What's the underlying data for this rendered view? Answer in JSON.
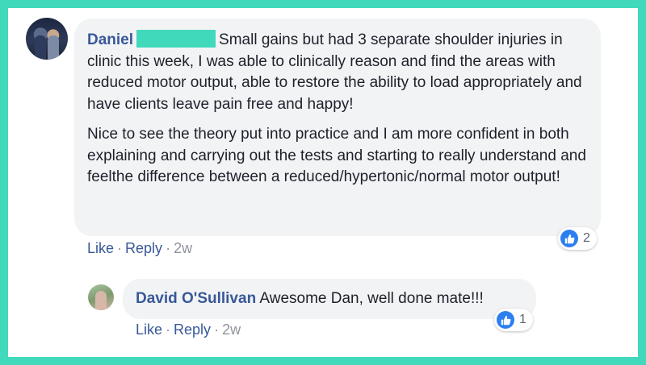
{
  "comment": {
    "author": "Daniel",
    "paragraphs": [
      "Small gains but had 3 separate shoulder injuries in clinic this week, I was able to clinically reason and find the areas with reduced motor output, able to restore the ability to load appropriately and have clients leave pain free and happy!",
      "Nice to see the theory put into practice and I am more confident in both explaining and carrying out the tests and starting to really understand and feelthe difference between a reduced/hypertonic/normal motor output!"
    ],
    "actions": {
      "like": "Like",
      "reply": "Reply",
      "separator": "·",
      "time": "2w"
    },
    "reaction": {
      "icon": "thumbs-up-icon",
      "count": "2"
    }
  },
  "reply": {
    "author": "David O'Sullivan",
    "text": "Awesome Dan, well done mate!!!",
    "actions": {
      "like": "Like",
      "reply": "Reply",
      "separator": "·",
      "time": "2w"
    },
    "reaction": {
      "icon": "thumbs-up-icon",
      "count": "1"
    }
  },
  "colors": {
    "frame": "#40d9bc",
    "bubble": "#f2f3f5",
    "link": "#385898",
    "like_badge": "#2d7ff0"
  }
}
